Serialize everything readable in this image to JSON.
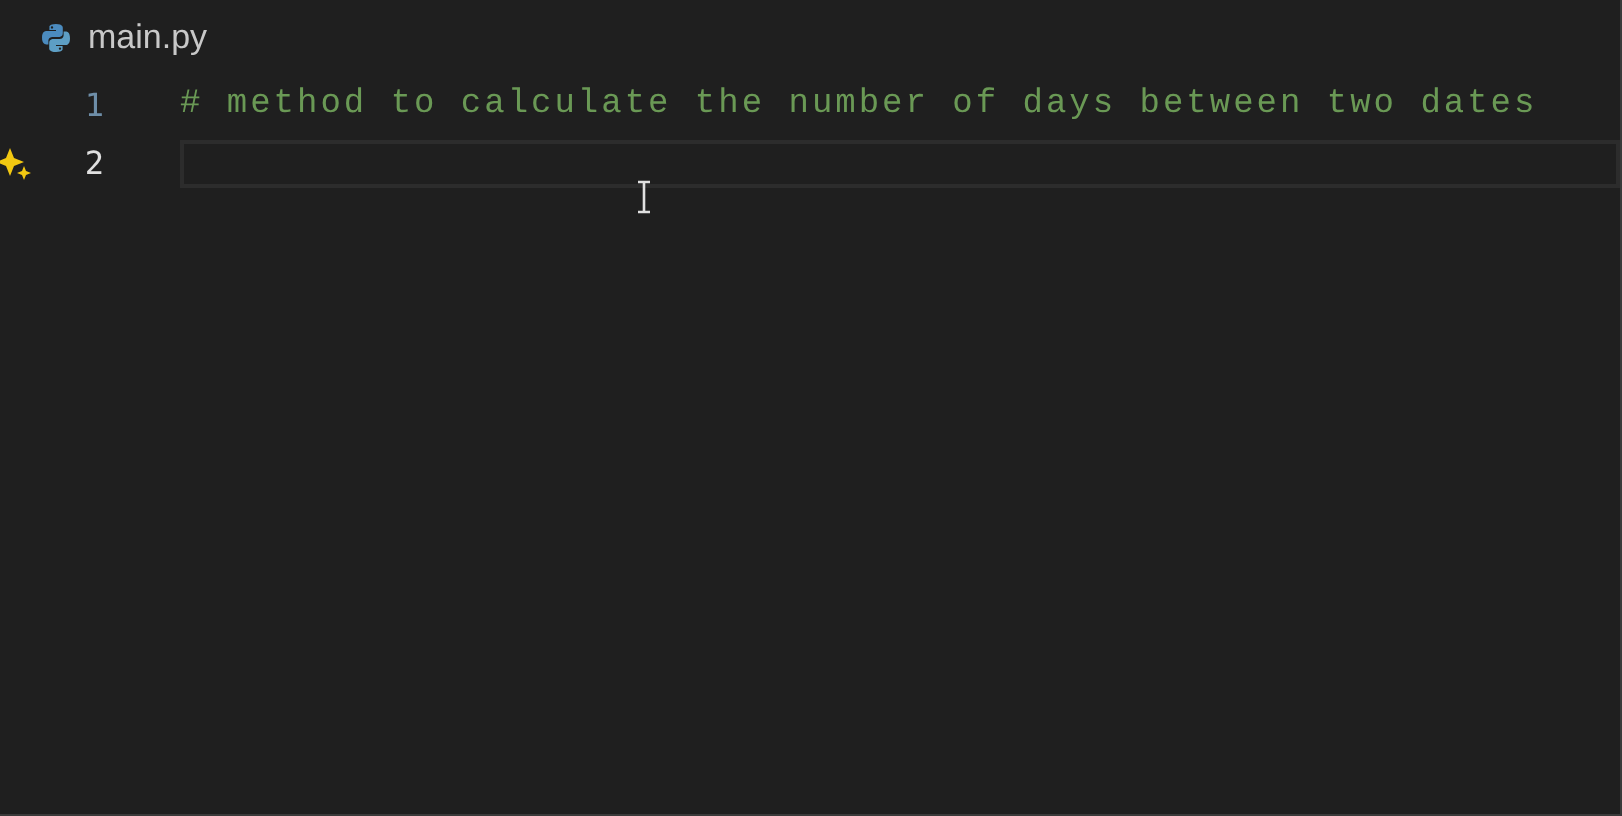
{
  "tab": {
    "title": "main.py"
  },
  "lines": [
    {
      "number": "1",
      "code": "# method to calculate the number of days between two dates",
      "current": false,
      "suggestion": false
    },
    {
      "number": "2",
      "current": true,
      "suggestion": true
    }
  ]
}
